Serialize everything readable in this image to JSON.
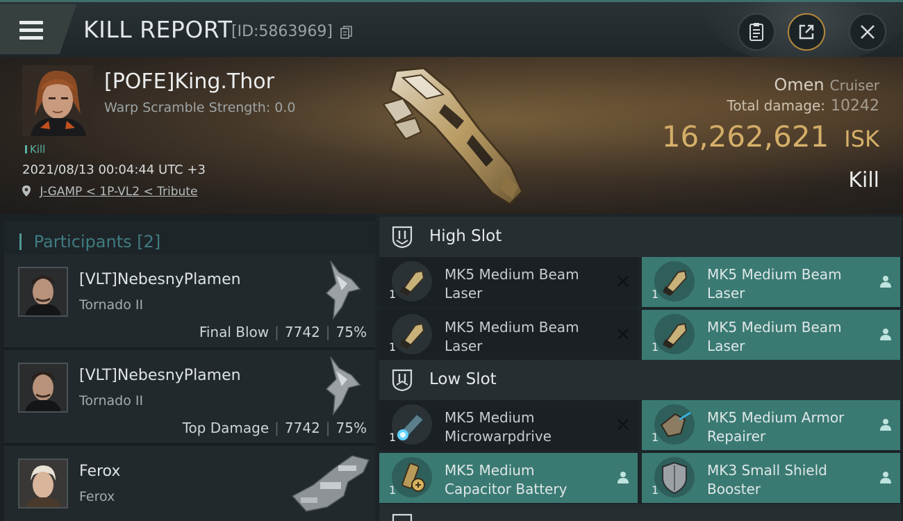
{
  "header": {
    "title": "KILL REPORT",
    "report_id": "[ID:5863969]",
    "icons": {
      "menu": "hamburger-menu-icon",
      "copy": "copy-icon",
      "clipboard": "clipboard-icon",
      "share": "share-icon",
      "close": "close-icon"
    }
  },
  "victim": {
    "name": "[POFE]King.Thor",
    "warp_scramble": "Warp Scramble Strength: 0.0",
    "tag": "Kill",
    "datetime": "2021/08/13 00:04:44 UTC +3",
    "location": "J-GAMP < 1P-VL2 < Tribute",
    "ship_name": "Omen",
    "ship_class": "Cruiser",
    "total_damage_label": "Total damage:",
    "total_damage": "10242",
    "isk_amount": "16,262,621",
    "isk_unit": "ISK",
    "result": "Kill"
  },
  "participants": {
    "title": "Participants",
    "count": "[2]",
    "rows": [
      {
        "name": "[VLT]NebesnyPlamen",
        "ship": "Tornado II",
        "role": "Final Blow",
        "damage": "7742",
        "percent": "75%"
      },
      {
        "name": "[VLT]NebesnyPlamen",
        "ship": "Tornado II",
        "role": "Top Damage",
        "damage": "7742",
        "percent": "75%"
      },
      {
        "name": "Ferox",
        "ship": "Ferox"
      }
    ]
  },
  "fitting": {
    "high_slot": {
      "title": "High Slot",
      "modules": [
        {
          "name": "MK5 Medium Beam Laser",
          "qty": "1",
          "status": "destroyed"
        },
        {
          "name": "MK5 Medium Beam Laser",
          "qty": "1",
          "status": "dropped"
        },
        {
          "name": "MK5 Medium Beam Laser",
          "qty": "1",
          "status": "destroyed"
        },
        {
          "name": "MK5 Medium Beam Laser",
          "qty": "1",
          "status": "dropped"
        }
      ]
    },
    "low_slot": {
      "title": "Low Slot",
      "modules": [
        {
          "name": "MK5 Medium Microwarpdrive",
          "qty": "1",
          "status": "destroyed"
        },
        {
          "name": "MK5 Medium Armor Repairer",
          "qty": "1",
          "status": "dropped"
        },
        {
          "name": "MK5 Medium Capacitor Battery",
          "qty": "1",
          "status": "dropped"
        },
        {
          "name": "MK3 Small Shield Booster",
          "qty": "1",
          "status": "dropped"
        }
      ]
    }
  }
}
